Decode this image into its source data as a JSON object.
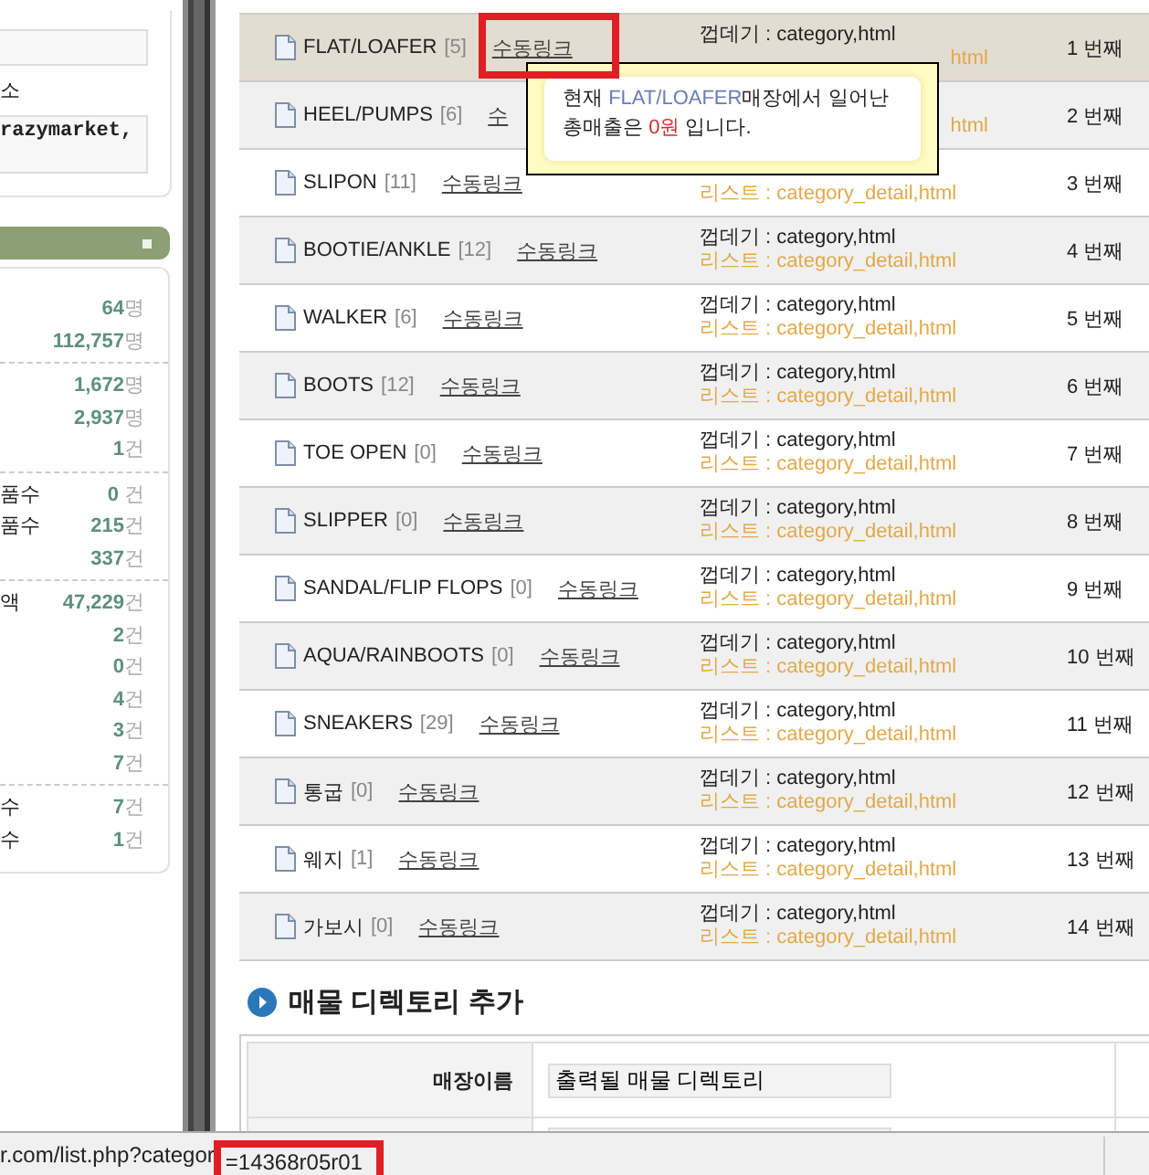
{
  "sidebar": {
    "field_label": "소",
    "store_field": {
      "value": "razymarket,"
    },
    "stats_groups": [
      [
        {
          "value": "64",
          "unit": "명"
        },
        {
          "value": "112,757",
          "unit": "명"
        }
      ],
      [
        {
          "value": "1,672",
          "unit": "명"
        },
        {
          "value": "2,937",
          "unit": "명"
        },
        {
          "value": "1",
          "unit": "건"
        }
      ],
      [
        {
          "label": "품수",
          "value": "0 ",
          "unit": "건"
        },
        {
          "label": "품수",
          "value": "215",
          "unit": "건"
        },
        {
          "value": "337",
          "unit": "건"
        }
      ],
      [
        {
          "label": "액",
          "value": "47,229",
          "unit": "건"
        },
        {
          "value": "2",
          "unit": "건"
        },
        {
          "value": "0",
          "unit": "건"
        },
        {
          "value": "4",
          "unit": "건"
        },
        {
          "value": "3",
          "unit": "건"
        },
        {
          "value": "7",
          "unit": "건"
        }
      ],
      [
        {
          "label": "수",
          "value": "7",
          "unit": "건"
        },
        {
          "label": "수",
          "value": "1",
          "unit": "건"
        }
      ]
    ]
  },
  "directory_rows": [
    {
      "name": "FLAT/LOAFER",
      "count": "[5]",
      "link": "수동링크",
      "selected": true,
      "template_lines": [
        {
          "kind": "shell",
          "text": "껍데기 : category,html",
          "clipped": false
        },
        {
          "kind": "list",
          "text": "html",
          "clipped": true
        }
      ],
      "order": "1 번째"
    },
    {
      "name": "HEEL/PUMPS",
      "count": "[6]",
      "link": "수",
      "selected": false,
      "template_lines": [
        {
          "kind": "list",
          "text": "html",
          "clipped": true
        }
      ],
      "order": "2 번째"
    },
    {
      "name": "SLIPON",
      "count": "[11]",
      "link": "수동링크",
      "selected": false,
      "template_lines": [
        {
          "kind": "list",
          "text": "리스트 : category_detail,html",
          "clipped": false
        }
      ],
      "order": "3 번째"
    },
    {
      "name": "BOOTIE/ANKLE",
      "count": "[12]",
      "link": "수동링크",
      "selected": false,
      "template_lines": [
        {
          "kind": "shell",
          "text": "껍데기 : category,html",
          "clipped": false
        },
        {
          "kind": "list",
          "text": "리스트 : category_detail,html",
          "clipped": false
        }
      ],
      "order": "4 번째"
    },
    {
      "name": "WALKER",
      "count": "[6]",
      "link": "수동링크",
      "selected": false,
      "template_lines": [
        {
          "kind": "shell",
          "text": "껍데기 : category,html",
          "clipped": false
        },
        {
          "kind": "list",
          "text": "리스트 : category_detail,html",
          "clipped": false
        }
      ],
      "order": "5 번째"
    },
    {
      "name": "BOOTS",
      "count": "[12]",
      "link": "수동링크",
      "selected": false,
      "template_lines": [
        {
          "kind": "shell",
          "text": "껍데기 : category,html",
          "clipped": false
        },
        {
          "kind": "list",
          "text": "리스트 : category_detail,html",
          "clipped": false
        }
      ],
      "order": "6 번째"
    },
    {
      "name": "TOE OPEN",
      "count": "[0]",
      "link": "수동링크",
      "selected": false,
      "template_lines": [
        {
          "kind": "shell",
          "text": "껍데기 : category,html",
          "clipped": false
        },
        {
          "kind": "list",
          "text": "리스트 : category_detail,html",
          "clipped": false
        }
      ],
      "order": "7 번째"
    },
    {
      "name": "SLIPPER",
      "count": "[0]",
      "link": "수동링크",
      "selected": false,
      "template_lines": [
        {
          "kind": "shell",
          "text": "껍데기 : category,html",
          "clipped": false
        },
        {
          "kind": "list",
          "text": "리스트 : category_detail,html",
          "clipped": false
        }
      ],
      "order": "8 번째"
    },
    {
      "name": "SANDAL/FLIP FLOPS",
      "count": "[0]",
      "link": "수동링크",
      "selected": false,
      "template_lines": [
        {
          "kind": "shell",
          "text": "껍데기 : category,html",
          "clipped": false
        },
        {
          "kind": "list",
          "text": "리스트 : category_detail,html",
          "clipped": false
        }
      ],
      "order": "9 번째"
    },
    {
      "name": "AQUA/RAINBOOTS",
      "count": "[0]",
      "link": "수동링크",
      "selected": false,
      "template_lines": [
        {
          "kind": "shell",
          "text": "껍데기 : category,html",
          "clipped": false
        },
        {
          "kind": "list",
          "text": "리스트 : category_detail,html",
          "clipped": false
        }
      ],
      "order": "10 번째"
    },
    {
      "name": "SNEAKERS",
      "count": "[29]",
      "link": "수동링크",
      "selected": false,
      "template_lines": [
        {
          "kind": "shell",
          "text": "껍데기 : category,html",
          "clipped": false
        },
        {
          "kind": "list",
          "text": "리스트 : category_detail,html",
          "clipped": false
        }
      ],
      "order": "11 번째"
    },
    {
      "name": "통굽",
      "count": "[0]",
      "link": "수동링크",
      "selected": false,
      "template_lines": [
        {
          "kind": "shell",
          "text": "껍데기 : category,html",
          "clipped": false
        },
        {
          "kind": "list",
          "text": "리스트 : category_detail,html",
          "clipped": false
        }
      ],
      "order": "12 번째"
    },
    {
      "name": "웨지",
      "count": "[1]",
      "link": "수동링크",
      "selected": false,
      "template_lines": [
        {
          "kind": "shell",
          "text": "껍데기 : category,html",
          "clipped": false
        },
        {
          "kind": "list",
          "text": "리스트 : category_detail,html",
          "clipped": false
        }
      ],
      "order": "13 번째"
    },
    {
      "name": "가보시",
      "count": "[0]",
      "link": "수동링크",
      "selected": false,
      "template_lines": [
        {
          "kind": "shell",
          "text": "껍데기 : category,html",
          "clipped": false
        },
        {
          "kind": "list",
          "text": "리스트 : category_detail,html",
          "clipped": false
        }
      ],
      "order": "14 번째"
    }
  ],
  "tooltip": {
    "segments": [
      {
        "kind": "plain",
        "text": "현재 "
      },
      {
        "kind": "store",
        "text": "FLAT/LOAFER"
      },
      {
        "kind": "plain",
        "text": "매장에서 일어난 총매출은 "
      },
      {
        "kind": "amount",
        "text": "0원"
      },
      {
        "kind": "plain",
        "text": " 입니다."
      }
    ]
  },
  "add_section": {
    "title": "매물 디렉토리 추가",
    "fields": [
      {
        "kind": "labeled",
        "label": "매장이름",
        "value": "출력될 매물 디렉토리"
      },
      {
        "kind": "blank"
      }
    ]
  },
  "status_bar": {
    "url": "r.com/list.php?categor",
    "highlighted": "=14368r05r01"
  }
}
